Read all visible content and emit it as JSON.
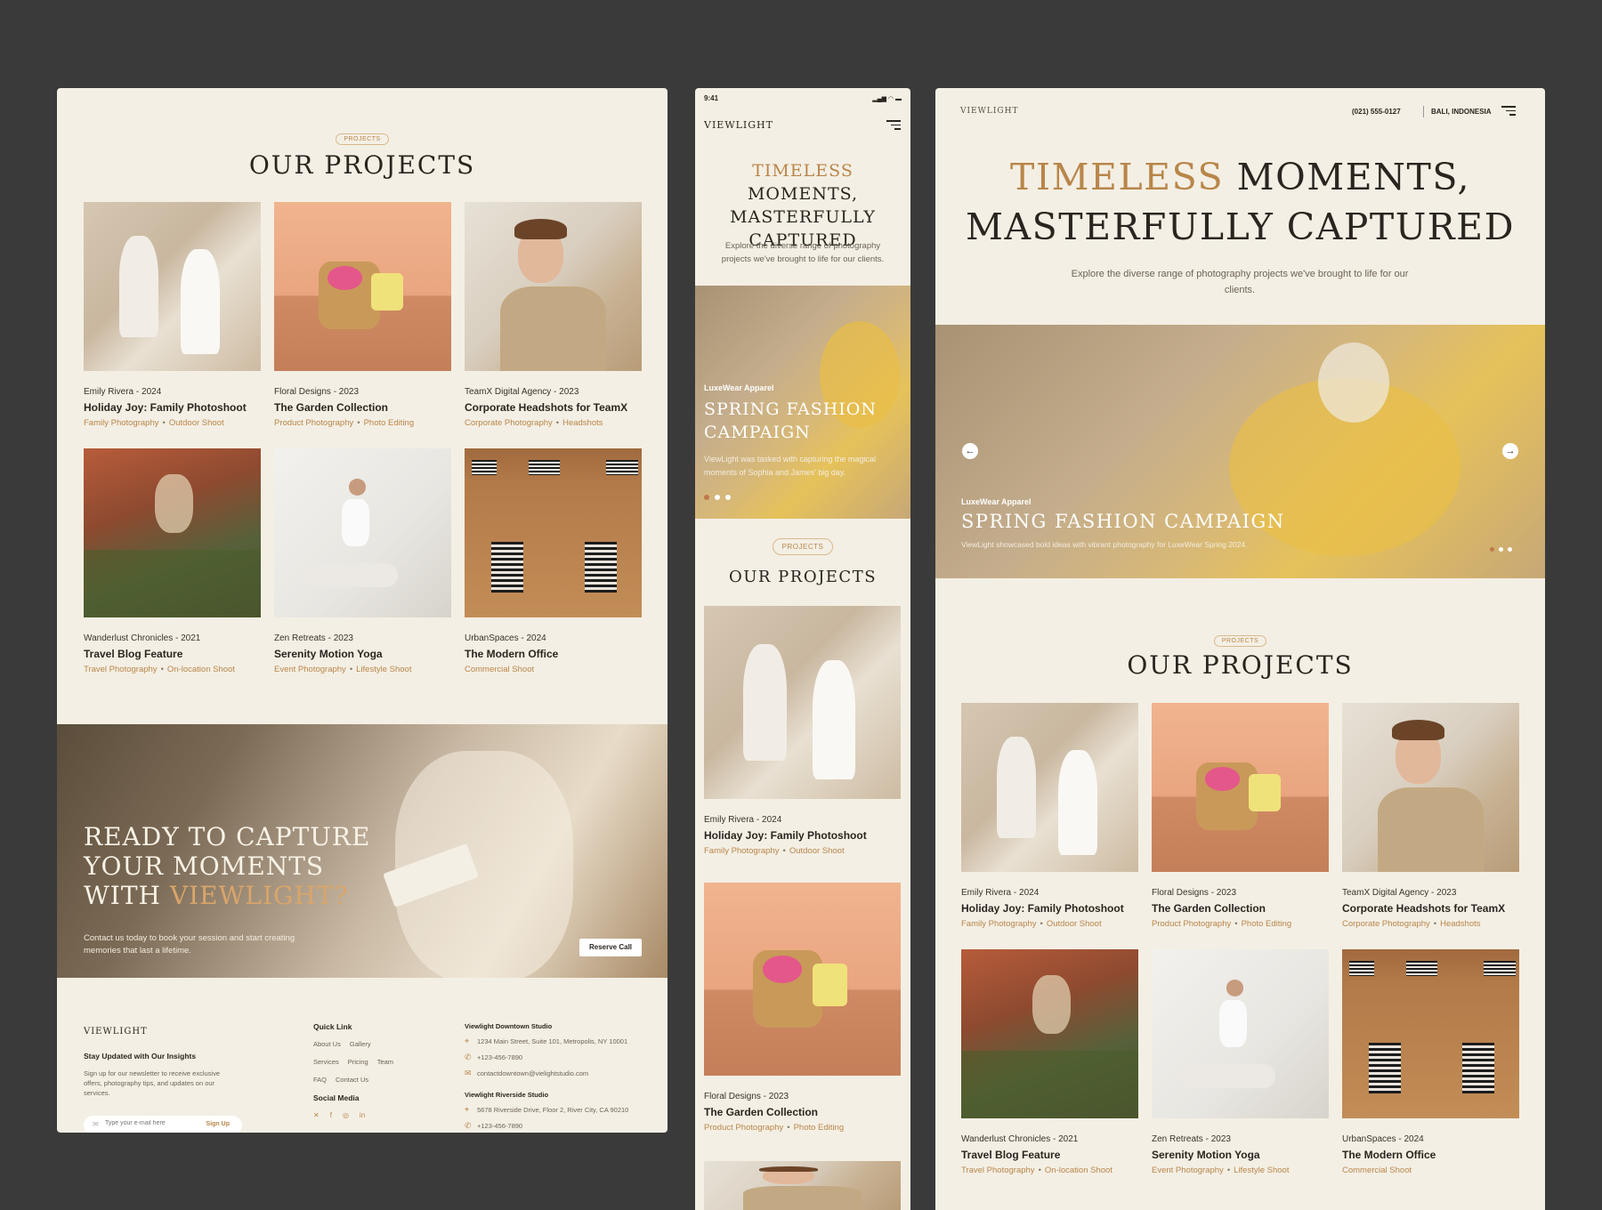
{
  "colors": {
    "background": "#3a3a3a",
    "canvas": "#f4efe4",
    "accent": "#b8864b",
    "text": "#2b2520"
  },
  "projects": [
    {
      "meta": "Emily Rivera - 2024",
      "title": "Holiday Joy: Family Photoshoot",
      "tags": [
        "Family Photography",
        "Outdoor Shoot"
      ],
      "image": "family-photo"
    },
    {
      "meta": "Floral Designs - 2023",
      "title": "The Garden Collection",
      "tags": [
        "Product Photography",
        "Photo Editing"
      ],
      "image": "garden-basket-photo"
    },
    {
      "meta": "TeamX Digital Agency - 2023",
      "title": "Corporate Headshots for TeamX",
      "tags": [
        "Corporate Photography",
        "Headshots"
      ],
      "image": "headshot-photo"
    },
    {
      "meta": "Wanderlust Chronicles - 2021",
      "title": "Travel Blog Feature",
      "tags": [
        "Travel Photography",
        "On-location Shoot"
      ],
      "image": "canyon-photo"
    },
    {
      "meta": "Zen Retreats - 2023",
      "title": "Serenity Motion Yoga",
      "tags": [
        "Event Photography",
        "Lifestyle Shoot"
      ],
      "image": "yoga-photo"
    },
    {
      "meta": "UrbanSpaces - 2024",
      "title": "The Modern Office",
      "tags": [
        "Commercial Shoot"
      ],
      "image": "office-photo"
    }
  ],
  "desktop_left": {
    "tag": "PROJECTS",
    "heading": "OUR PROJECTS",
    "cta": {
      "line1": "READY TO CAPTURE",
      "line2": "YOUR MOMENTS",
      "line3_prefix": "WITH ",
      "line3_accent": "VIEWLIGHT?",
      "body": "Contact us today to book your session and start creating memories that last a lifetime.",
      "button": "Reserve Call"
    },
    "footer": {
      "brand": "VIEWLIGHT",
      "newsletter_title": "Stay Updated with Our Insights",
      "newsletter_text": "Sign up for our newsletter to receive exclusive offers, photography tips, and updates on our services.",
      "email_placeholder": "Type your e-mail here",
      "signup": "Sign Up",
      "quick_link_title": "Quick Link",
      "quick_links": [
        "About Us",
        "Gallery",
        "Services",
        "Pricing",
        "Team",
        "FAQ",
        "Contact Us"
      ],
      "social_title": "Social Media",
      "studio1_title": "Viewlight Downtown Studio",
      "studio1_address": "1234 Main Street, Suite 101, Metropolis, NY 10001",
      "studio1_phone": "+123-456-7890",
      "studio1_email": "contactdowntown@vielightstudio.com",
      "studio2_title": "Viewlight Riverside Studio",
      "studio2_address": "5678 Riverside Drive, Floor 2, River City, CA 90210",
      "studio2_phone": "+123-456-7890"
    }
  },
  "mobile": {
    "time": "9:41",
    "brand": "VIEWLIGHT",
    "hero_accent": "TIMELESS",
    "hero_rest1": " MOMENTS,",
    "hero_line2": "MASTERFULLY",
    "hero_line3": "CAPTURED",
    "hero_sub": "Explore the diverse range of photography projects we've brought to life for our clients.",
    "slide_client": "LuxeWear Apparel",
    "slide_title_1": "SPRING FASHION",
    "slide_title_2": "CAMPAIGN",
    "slide_text": "ViewLight was tasked with capturing the magical moments of Sophia and James' big day.",
    "tag": "PROJECTS",
    "heading": "OUR PROJECTS"
  },
  "desktop_right": {
    "brand": "VIEWLIGHT",
    "phone": "(021) 555-0127",
    "location": "BALI, INDONESIA",
    "hero_accent": "TIMELESS",
    "hero_rest1": " MOMENTS,",
    "hero_line2": "MASTERFULLY CAPTURED",
    "hero_sub": "Explore the diverse range of photography projects we've brought to life for our clients.",
    "slide_client": "LuxeWear Apparel",
    "slide_title": "SPRING FASHION CAMPAIGN",
    "slide_text": "ViewLight showcased bold ideas with vibrant photography for LuxeWear Spring 2024.",
    "prev_icon": "arrow-left-icon",
    "next_icon": "arrow-right-icon",
    "tag": "PROJECTS",
    "heading": "OUR PROJECTS"
  }
}
